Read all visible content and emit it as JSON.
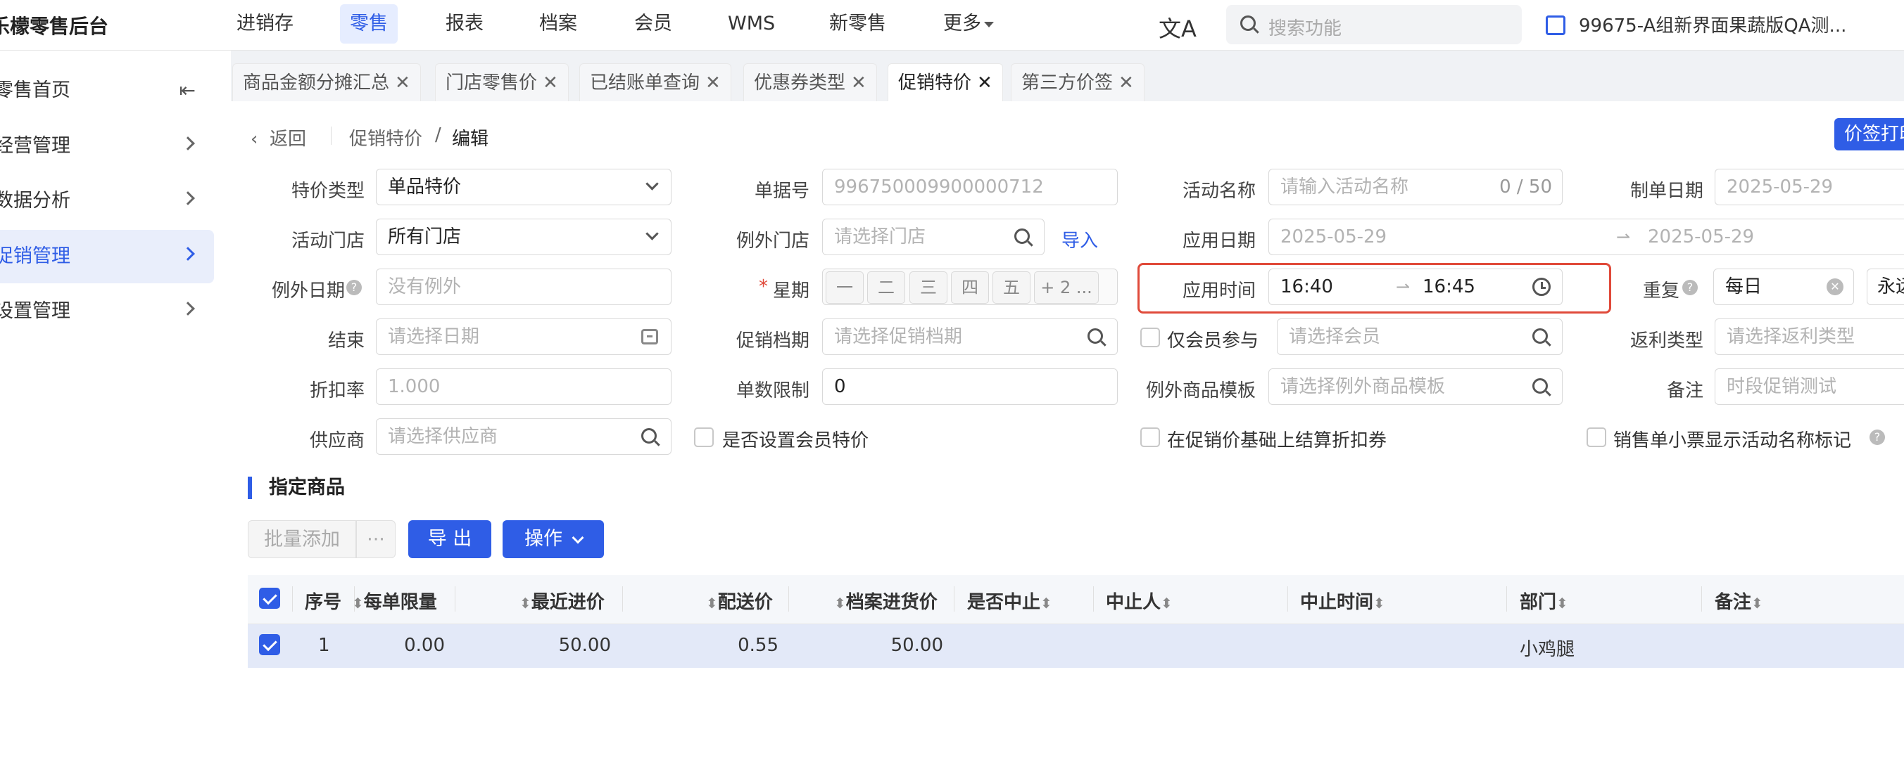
{
  "app": {
    "logo": "乐檬零售后台",
    "nav": [
      "进销存",
      "零售",
      "报表",
      "档案",
      "会员",
      "WMS",
      "新零售",
      "更多"
    ],
    "search_placeholder": "搜索功能",
    "org_name": "99675-A组新界面果蔬版QA测..."
  },
  "sidebar": {
    "items": [
      {
        "label": "零售首页"
      },
      {
        "label": "经营管理"
      },
      {
        "label": "数据分析"
      },
      {
        "label": "促销管理"
      },
      {
        "label": "设置管理"
      }
    ]
  },
  "tabs": [
    {
      "label": "商品金额分摊汇总"
    },
    {
      "label": "门店零售价"
    },
    {
      "label": "已结账单查询"
    },
    {
      "label": "优惠券类型"
    },
    {
      "label": "促销特价"
    },
    {
      "label": "第三方价签"
    }
  ],
  "breadcrumb": {
    "back": "返回",
    "parent": "促销特价",
    "sep": "/",
    "current": "编辑"
  },
  "print_button": "价签打印",
  "form": {
    "special_type": {
      "label": "特价类型",
      "value": "单品特价"
    },
    "doc_no": {
      "label": "单据号",
      "value": "996750009900000712"
    },
    "activity_name": {
      "label": "活动名称",
      "placeholder": "请输入活动名称",
      "count": "0 / 50"
    },
    "create_date": {
      "label": "制单日期",
      "value": "2025-05-29"
    },
    "store": {
      "label": "活动门店",
      "value": "所有门店"
    },
    "except_store": {
      "label": "例外门店",
      "placeholder": "请选择门店",
      "import": "导入"
    },
    "apply_date": {
      "label": "应用日期",
      "start": "2025-05-29",
      "end": "2025-05-29"
    },
    "except_date": {
      "label": "例外日期",
      "placeholder": "没有例外"
    },
    "weekday": {
      "required": "*",
      "label": "星期",
      "days": [
        "一",
        "二",
        "三",
        "四",
        "五"
      ],
      "more": "+ 2 ..."
    },
    "apply_time": {
      "label": "应用时间",
      "start": "16:40",
      "end": "16:45"
    },
    "repeat": {
      "label": "重复",
      "value": "每日",
      "extra": "永远"
    },
    "end": {
      "label": "结束",
      "placeholder": "请选择日期"
    },
    "promo_level": {
      "label": "促销档期",
      "placeholder": "请选择促销档期"
    },
    "member_only": {
      "label": "仅会员参与",
      "placeholder": "请选择会员"
    },
    "rebate_type": {
      "label": "返利类型",
      "placeholder": "请选择返利类型"
    },
    "discount_rate": {
      "label": "折扣率",
      "placeholder": "1.000"
    },
    "order_limit": {
      "label": "单数限制",
      "value": "0"
    },
    "except_template": {
      "label": "例外商品模板",
      "placeholder": "请选择例外商品模板"
    },
    "remark": {
      "label": "备注",
      "placeholder": "时段促销测试"
    },
    "supplier": {
      "label": "供应商",
      "placeholder": "请选择供应商"
    },
    "member_price": {
      "label": "是否设置会员特价"
    },
    "settle_coupon": {
      "label": "在促销价基础上结算折扣券"
    },
    "receipt_mark": {
      "label": "销售单小票显示活动名称标记"
    }
  },
  "section": {
    "title": "指定商品",
    "batch_add": "批量添加",
    "more": "···",
    "export": "导 出",
    "operate": "操作"
  },
  "table": {
    "columns": [
      "序号",
      "每单限量",
      "最近进价",
      "配送价",
      "档案进货价",
      "是否中止",
      "中止人",
      "中止时间",
      "部门",
      "备注"
    ],
    "rows": [
      {
        "no": "1",
        "limit": "0.00",
        "recent_price": "50.00",
        "delivery_price": "0.55",
        "archive_price": "50.00",
        "stopped": "",
        "stopper": "",
        "stop_time": "",
        "dept": "小鸡腿",
        "remark": ""
      }
    ]
  },
  "colors": {
    "accent": "#2f5de6",
    "highlight": "#e04a3a"
  }
}
